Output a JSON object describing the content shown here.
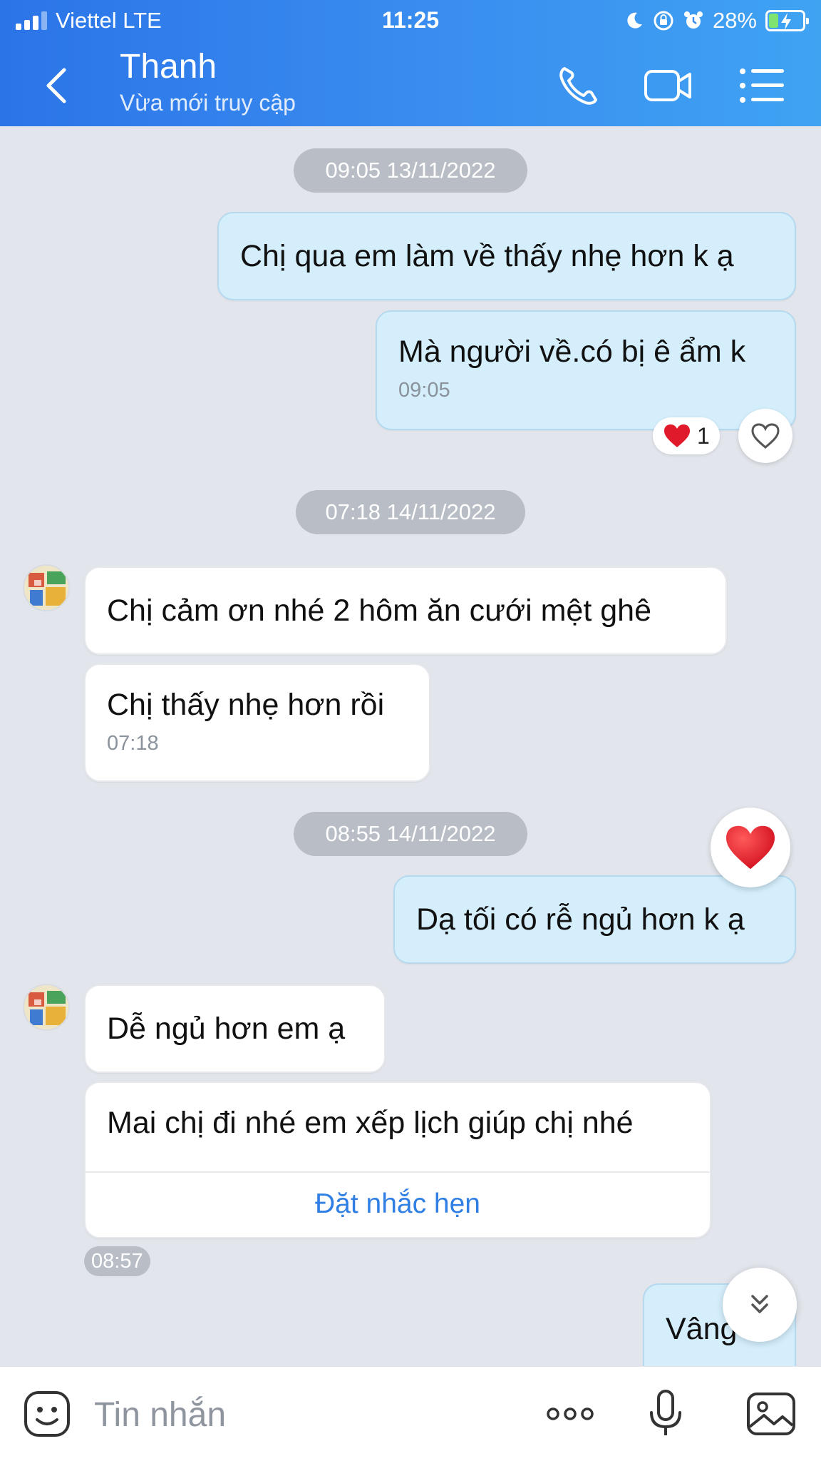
{
  "status_bar": {
    "carrier": "Viettel  LTE",
    "time": "11:25",
    "battery_percent": "28%",
    "battery_level": 0.28,
    "icons": [
      "signal-icon",
      "moon-icon",
      "lock-rotation-icon",
      "alarm-icon",
      "battery-charging-icon"
    ]
  },
  "header": {
    "contact_name": "Thanh",
    "presence": "Vừa mới truy cập",
    "icons": [
      "back-icon",
      "phone-icon",
      "video-icon",
      "menu-icon"
    ]
  },
  "conversation": {
    "date_1": "09:05 13/11/2022",
    "out_msg_1": "Chị qua em làm về thấy nhẹ hơn k ạ",
    "out_msg_2": "Mà người về.có bị ê ẩm k",
    "out_msg_2_time": "09:05",
    "reaction_count": "1",
    "date_2": "07:18 14/11/2022",
    "in_msg_1": "Chị cảm ơn nhé  2 hôm ăn cưới mệt ghê",
    "in_msg_2": "Chị thấy nhẹ hơn rồi",
    "in_msg_2_time": "07:18",
    "date_3": "08:55 14/11/2022",
    "out_msg_3": "Dạ tối có rễ ngủ hơn k ạ",
    "in_msg_3": "Dễ ngủ hơn em ạ",
    "in_msg_4": "Mai chị đi nhé em xếp lịch giúp chị nhé",
    "set_reminder": "Đặt nhắc hẹn",
    "in_msg_4_time": "08:57",
    "out_msg_4": "Vâng"
  },
  "input": {
    "placeholder": "Tin nhắn",
    "icons": [
      "sticker-icon",
      "more-icon",
      "microphone-icon",
      "image-icon"
    ]
  },
  "colors": {
    "header_start": "#2b74e8",
    "header_end": "#3fa3f2",
    "outgoing_bubble": "#d4eefc",
    "incoming_bubble": "#ffffff",
    "background": "#e2e6ec",
    "link": "#2f7fe4",
    "heart": "#e0192b"
  }
}
